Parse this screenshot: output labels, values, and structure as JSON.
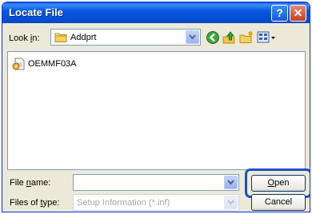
{
  "window": {
    "title": "Locate File"
  },
  "titlebar": {
    "help_icon": "help-icon",
    "close_icon": "close-icon"
  },
  "lookin": {
    "label_pre": "Look ",
    "label_accel": "i",
    "label_post": "n:",
    "value": "Addprt"
  },
  "toolbar": {
    "icons": [
      "back-icon",
      "up-folder-icon",
      "new-folder-icon",
      "view-menu-icon"
    ]
  },
  "files": [
    {
      "name": "OEMMF03A",
      "icon": "setup-info-file-icon"
    }
  ],
  "filename": {
    "label_pre": "File ",
    "label_accel": "n",
    "label_post": "ame:",
    "value": ""
  },
  "filetype": {
    "label_pre": "Files of ",
    "label_accel": "t",
    "label_post": "ype:",
    "value": "Setup Information (*.inf)"
  },
  "buttons": {
    "open_accel": "O",
    "open_rest": "pen",
    "cancel": "Cancel"
  },
  "colors": {
    "titlebar": "#0a58e0",
    "dialog_bg": "#ece9d8",
    "focus_ring": "#1f4fc8"
  }
}
